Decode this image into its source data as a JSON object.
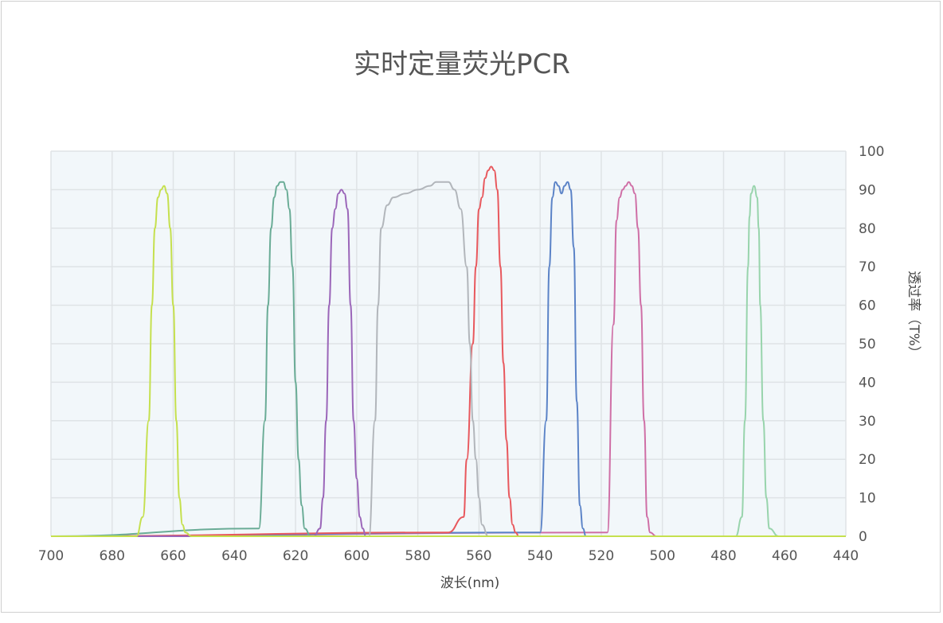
{
  "chart_data": {
    "type": "line",
    "title": "实时定量荧光PCR",
    "xlabel": "波长(nm)",
    "ylabel": "透过率（T%）",
    "x_reversed": true,
    "y_axis_side": "right",
    "xlim": [
      440,
      700
    ],
    "ylim": [
      0,
      100
    ],
    "x_ticks": [
      440,
      460,
      480,
      500,
      520,
      540,
      560,
      580,
      600,
      620,
      640,
      660,
      680,
      700
    ],
    "y_ticks": [
      0,
      10,
      20,
      30,
      40,
      50,
      60,
      70,
      80,
      90,
      100
    ],
    "grid": true,
    "plot_background": "#f2f7fa",
    "series": [
      {
        "color": "#98d4ac",
        "x": [
          440,
          462,
          465,
          466,
          467,
          468,
          468.5,
          469,
          470,
          471,
          471.5,
          472,
          473,
          474,
          476,
          700
        ],
        "y": [
          0,
          0,
          2,
          10,
          30,
          60,
          80,
          88,
          91,
          89,
          83,
          70,
          30,
          5,
          0,
          0
        ]
      },
      {
        "color": "#cf6fa6",
        "x": [
          440,
          502,
          504,
          505,
          506,
          507,
          508,
          509,
          510,
          511,
          512,
          513,
          514,
          515,
          516,
          518,
          700
        ],
        "y": [
          0,
          0,
          1,
          5,
          30,
          60,
          80,
          89,
          91,
          92,
          91,
          90,
          88,
          82,
          55,
          1,
          0
        ]
      },
      {
        "color": "#5b83c7",
        "x": [
          440,
          525,
          526,
          527,
          528,
          529,
          530,
          531,
          532,
          533,
          534,
          535,
          536,
          537,
          538,
          540,
          700
        ],
        "y": [
          0,
          0,
          2,
          8,
          35,
          75,
          90,
          92,
          91,
          89,
          91,
          92,
          88,
          70,
          30,
          1,
          0
        ]
      },
      {
        "color": "#e8585d",
        "x": [
          440,
          547,
          548,
          549,
          550,
          551,
          552,
          553,
          554,
          555,
          556,
          557,
          558,
          559,
          560,
          561,
          562,
          564,
          565,
          570,
          700
        ],
        "y": [
          0,
          0,
          1,
          3,
          10,
          25,
          45,
          70,
          90,
          95,
          96,
          95,
          93,
          88,
          85,
          70,
          50,
          20,
          5,
          1,
          0
        ]
      },
      {
        "color": "#b2b6bb",
        "x": [
          440,
          557,
          559,
          560,
          561,
          562,
          563,
          564,
          566,
          568,
          570,
          572,
          574,
          576,
          580,
          584,
          588,
          590,
          592,
          593,
          594,
          596,
          700
        ],
        "y": [
          0,
          0,
          3,
          10,
          20,
          30,
          50,
          70,
          85,
          90,
          92,
          92,
          92,
          91,
          90,
          89,
          88,
          86,
          80,
          60,
          30,
          0,
          0
        ]
      },
      {
        "color": "#9b66b9",
        "x": [
          440,
          597,
          598,
          599,
          600,
          601,
          602,
          603,
          604,
          605,
          606,
          607,
          608,
          609,
          610,
          611,
          612,
          614,
          700
        ],
        "y": [
          0,
          0,
          2,
          5,
          15,
          30,
          60,
          85,
          89,
          90,
          89,
          85,
          80,
          60,
          30,
          10,
          2,
          0,
          0
        ]
      },
      {
        "color": "#6aac96",
        "x": [
          440,
          615,
          617,
          618,
          619,
          620,
          621,
          622,
          623,
          624,
          625,
          626,
          627,
          628,
          629,
          630,
          632,
          700
        ],
        "y": [
          0,
          0,
          2,
          8,
          20,
          40,
          70,
          85,
          90,
          92,
          92,
          91,
          88,
          80,
          60,
          30,
          2,
          0
        ]
      },
      {
        "color": "#c5e04e",
        "x": [
          440,
          654,
          656,
          657,
          658,
          659,
          660,
          661,
          662,
          663,
          664,
          665,
          666,
          667,
          668,
          670,
          672,
          700
        ],
        "y": [
          0,
          0,
          1,
          3,
          10,
          30,
          60,
          80,
          89,
          91,
          90,
          88,
          80,
          60,
          30,
          5,
          0,
          0
        ]
      }
    ]
  }
}
